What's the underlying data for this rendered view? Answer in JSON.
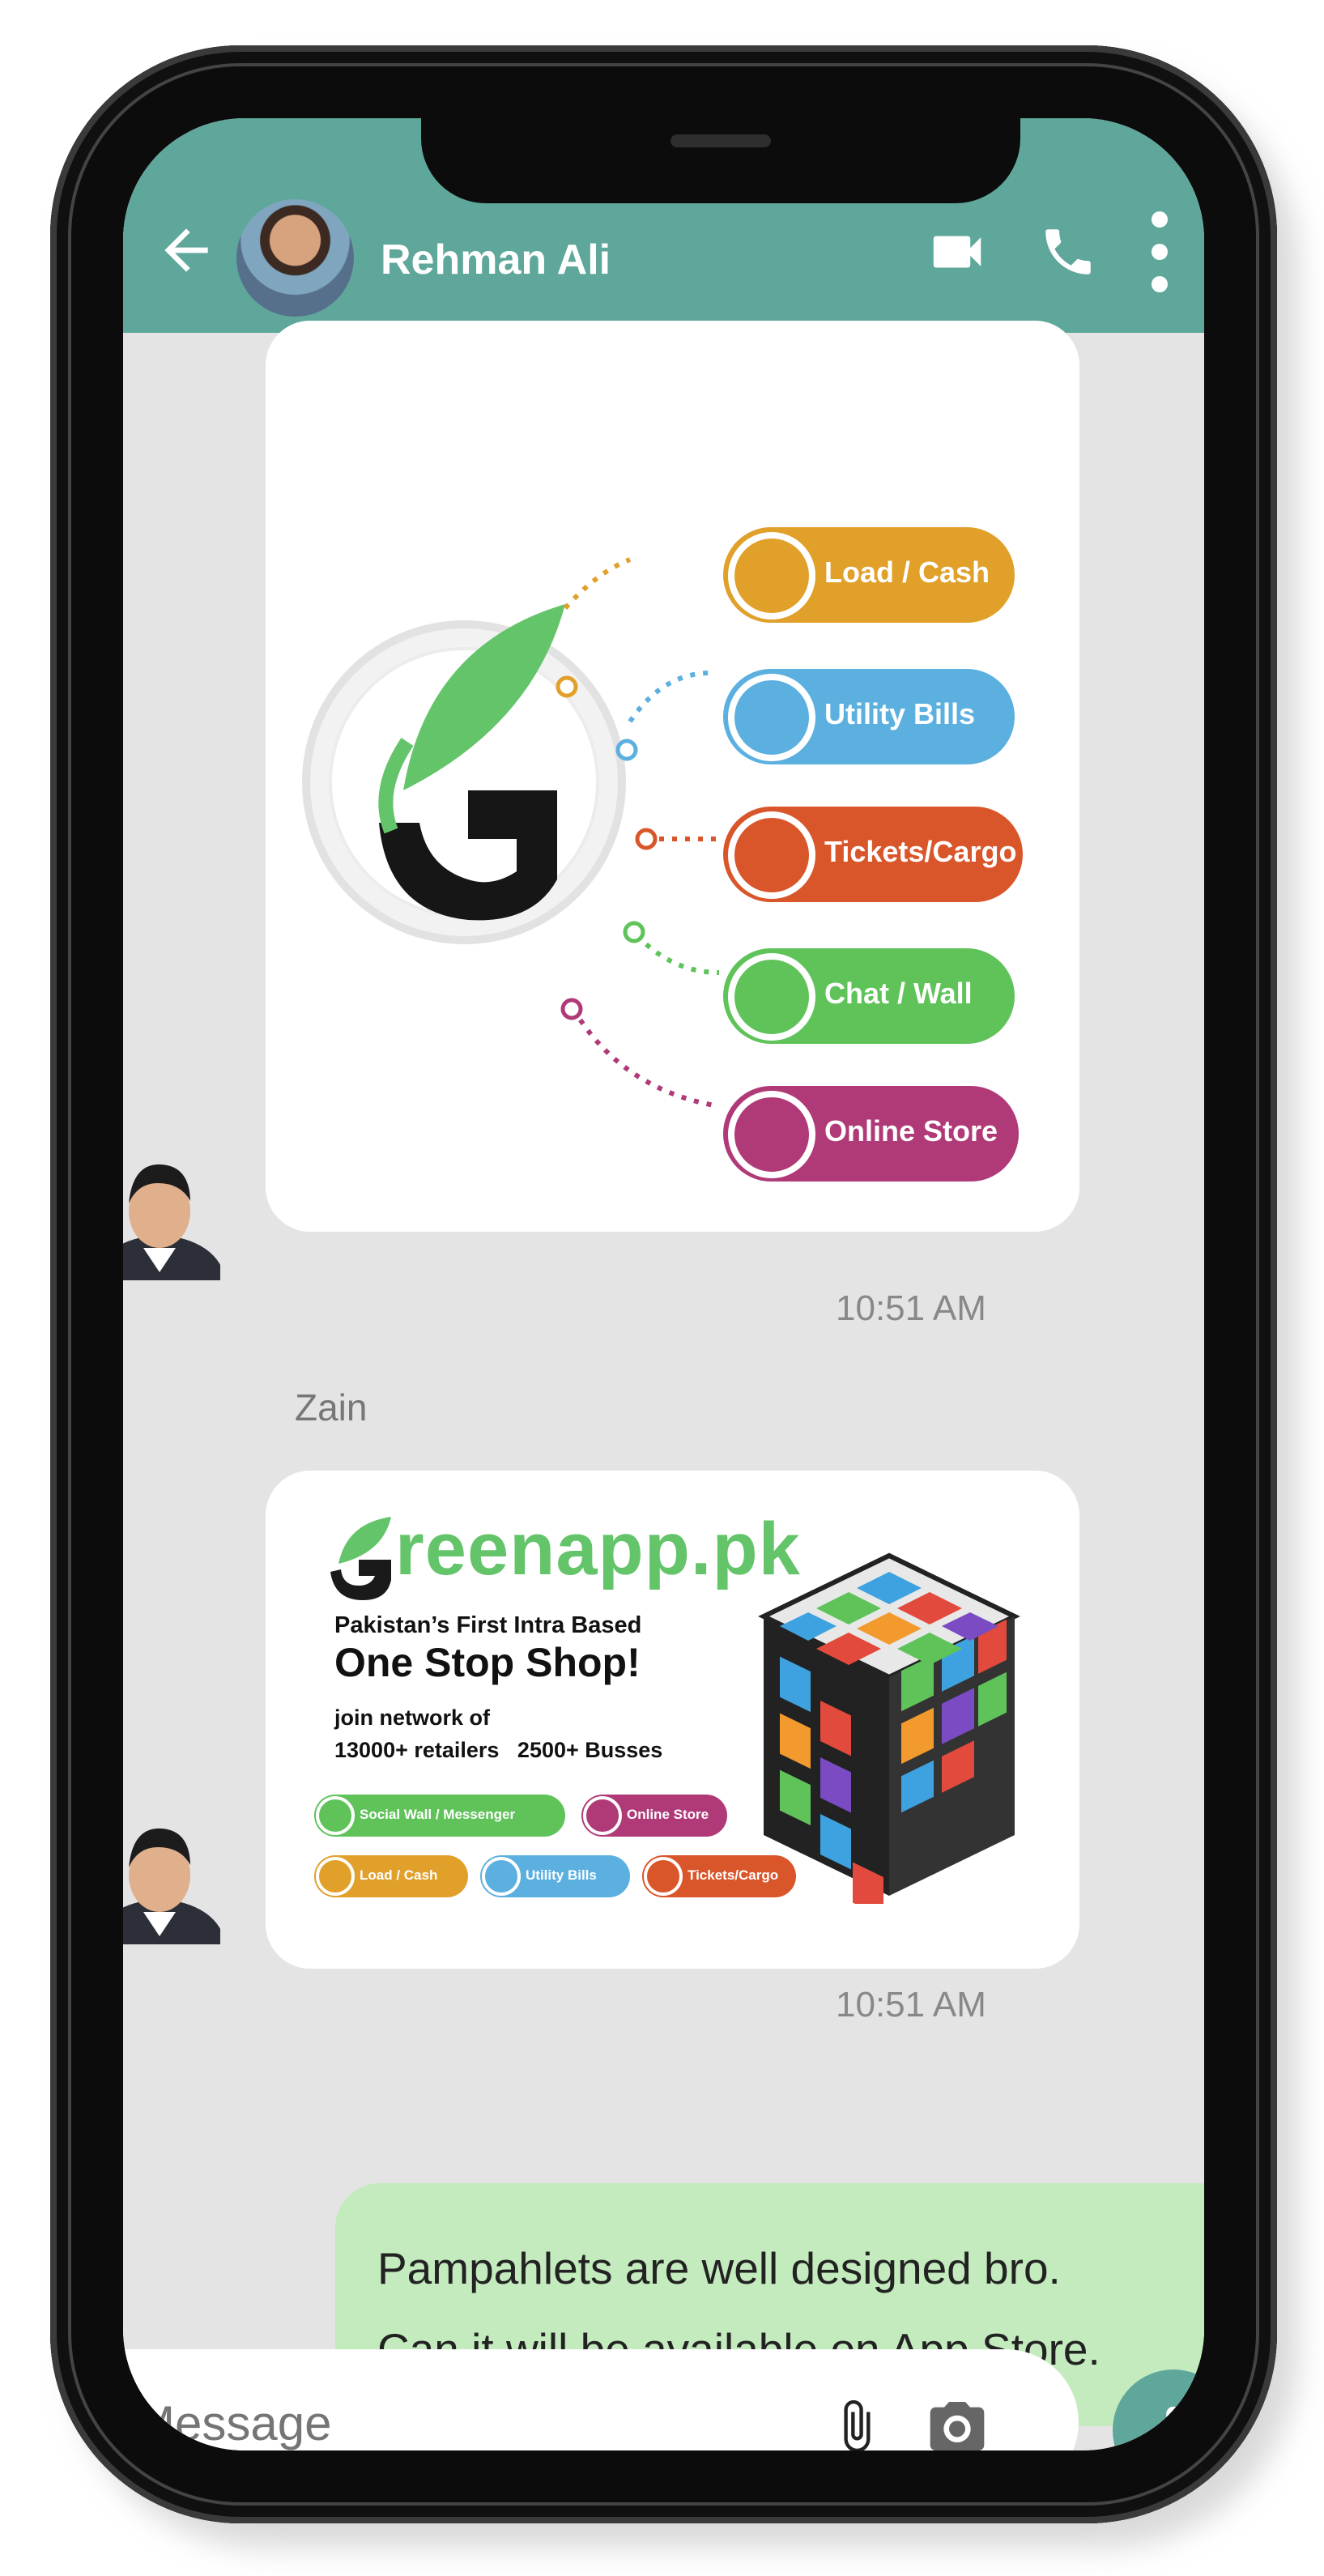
{
  "header": {
    "contact_name": "Rehman Ali"
  },
  "messages": [
    {
      "type": "image",
      "time": "10:51 AM",
      "image": {
        "pills": [
          {
            "label": "Load / Cash",
            "color": "#e0a02a"
          },
          {
            "label": "Utility Bills",
            "color": "#5bb0e0"
          },
          {
            "label": "Tickets/Cargo",
            "color": "#d9562a"
          },
          {
            "label": "Chat / Wall",
            "color": "#5fc35a"
          },
          {
            "label": "Online Store",
            "color": "#b03a78"
          }
        ]
      }
    },
    {
      "type": "image",
      "sender": "Zain",
      "time": "10:51 AM",
      "image": {
        "brand_rest": "reenapp.pk",
        "tagline": "Pakistan’s First Intra Based",
        "headline": "One Stop Shop!",
        "line1": "join network of",
        "line2": "13000+ retailers   2500+ Busses",
        "pills": [
          {
            "label": "Social Wall / Messenger",
            "color": "#5fc35a"
          },
          {
            "label": "Online Store",
            "color": "#b03a78"
          },
          {
            "label": "Load / Cash",
            "color": "#e0a02a"
          },
          {
            "label": "Utility Bills",
            "color": "#5bb0e0"
          },
          {
            "label": "Tickets/Cargo",
            "color": "#d9562a"
          }
        ]
      }
    },
    {
      "type": "text",
      "direction": "outgoing",
      "text": "Pampahlets are well designed bro.\nCan it will be available on App Store."
    }
  ],
  "composer": {
    "placeholder": "Message"
  },
  "icons": [
    "back-arrow-icon",
    "video-call-icon",
    "phone-icon",
    "more-vert-icon",
    "attachment-icon",
    "camera-icon",
    "microphone-icon"
  ],
  "colors": {
    "header": "#5ea79a",
    "outgoing_bubble": "#c3ebbe",
    "chat_bg": "#e4e4e4"
  }
}
